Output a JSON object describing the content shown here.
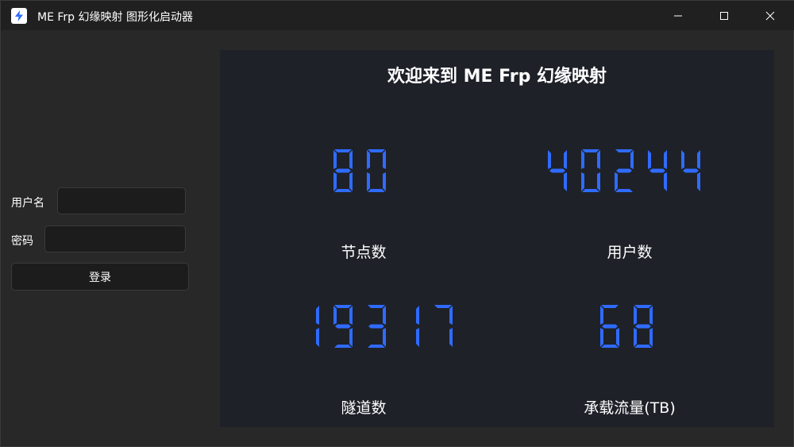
{
  "window": {
    "title": "ME Frp 幻缘映射 图形化启动器",
    "icon": "lightning-icon",
    "accent": "#2f6bff"
  },
  "login": {
    "username_label": "用户名",
    "username_value": "",
    "password_label": "密码",
    "password_value": "",
    "login_button": "登录"
  },
  "stats": {
    "welcome": "欢迎来到 ME Frp 幻缘映射",
    "digit_color": "#2f6bff",
    "items": [
      {
        "value": "80",
        "label": "节点数"
      },
      {
        "value": "40244",
        "label": "用户数"
      },
      {
        "value": "19317",
        "label": "隧道数"
      },
      {
        "value": "68",
        "label": "承载流量(TB)"
      }
    ]
  }
}
